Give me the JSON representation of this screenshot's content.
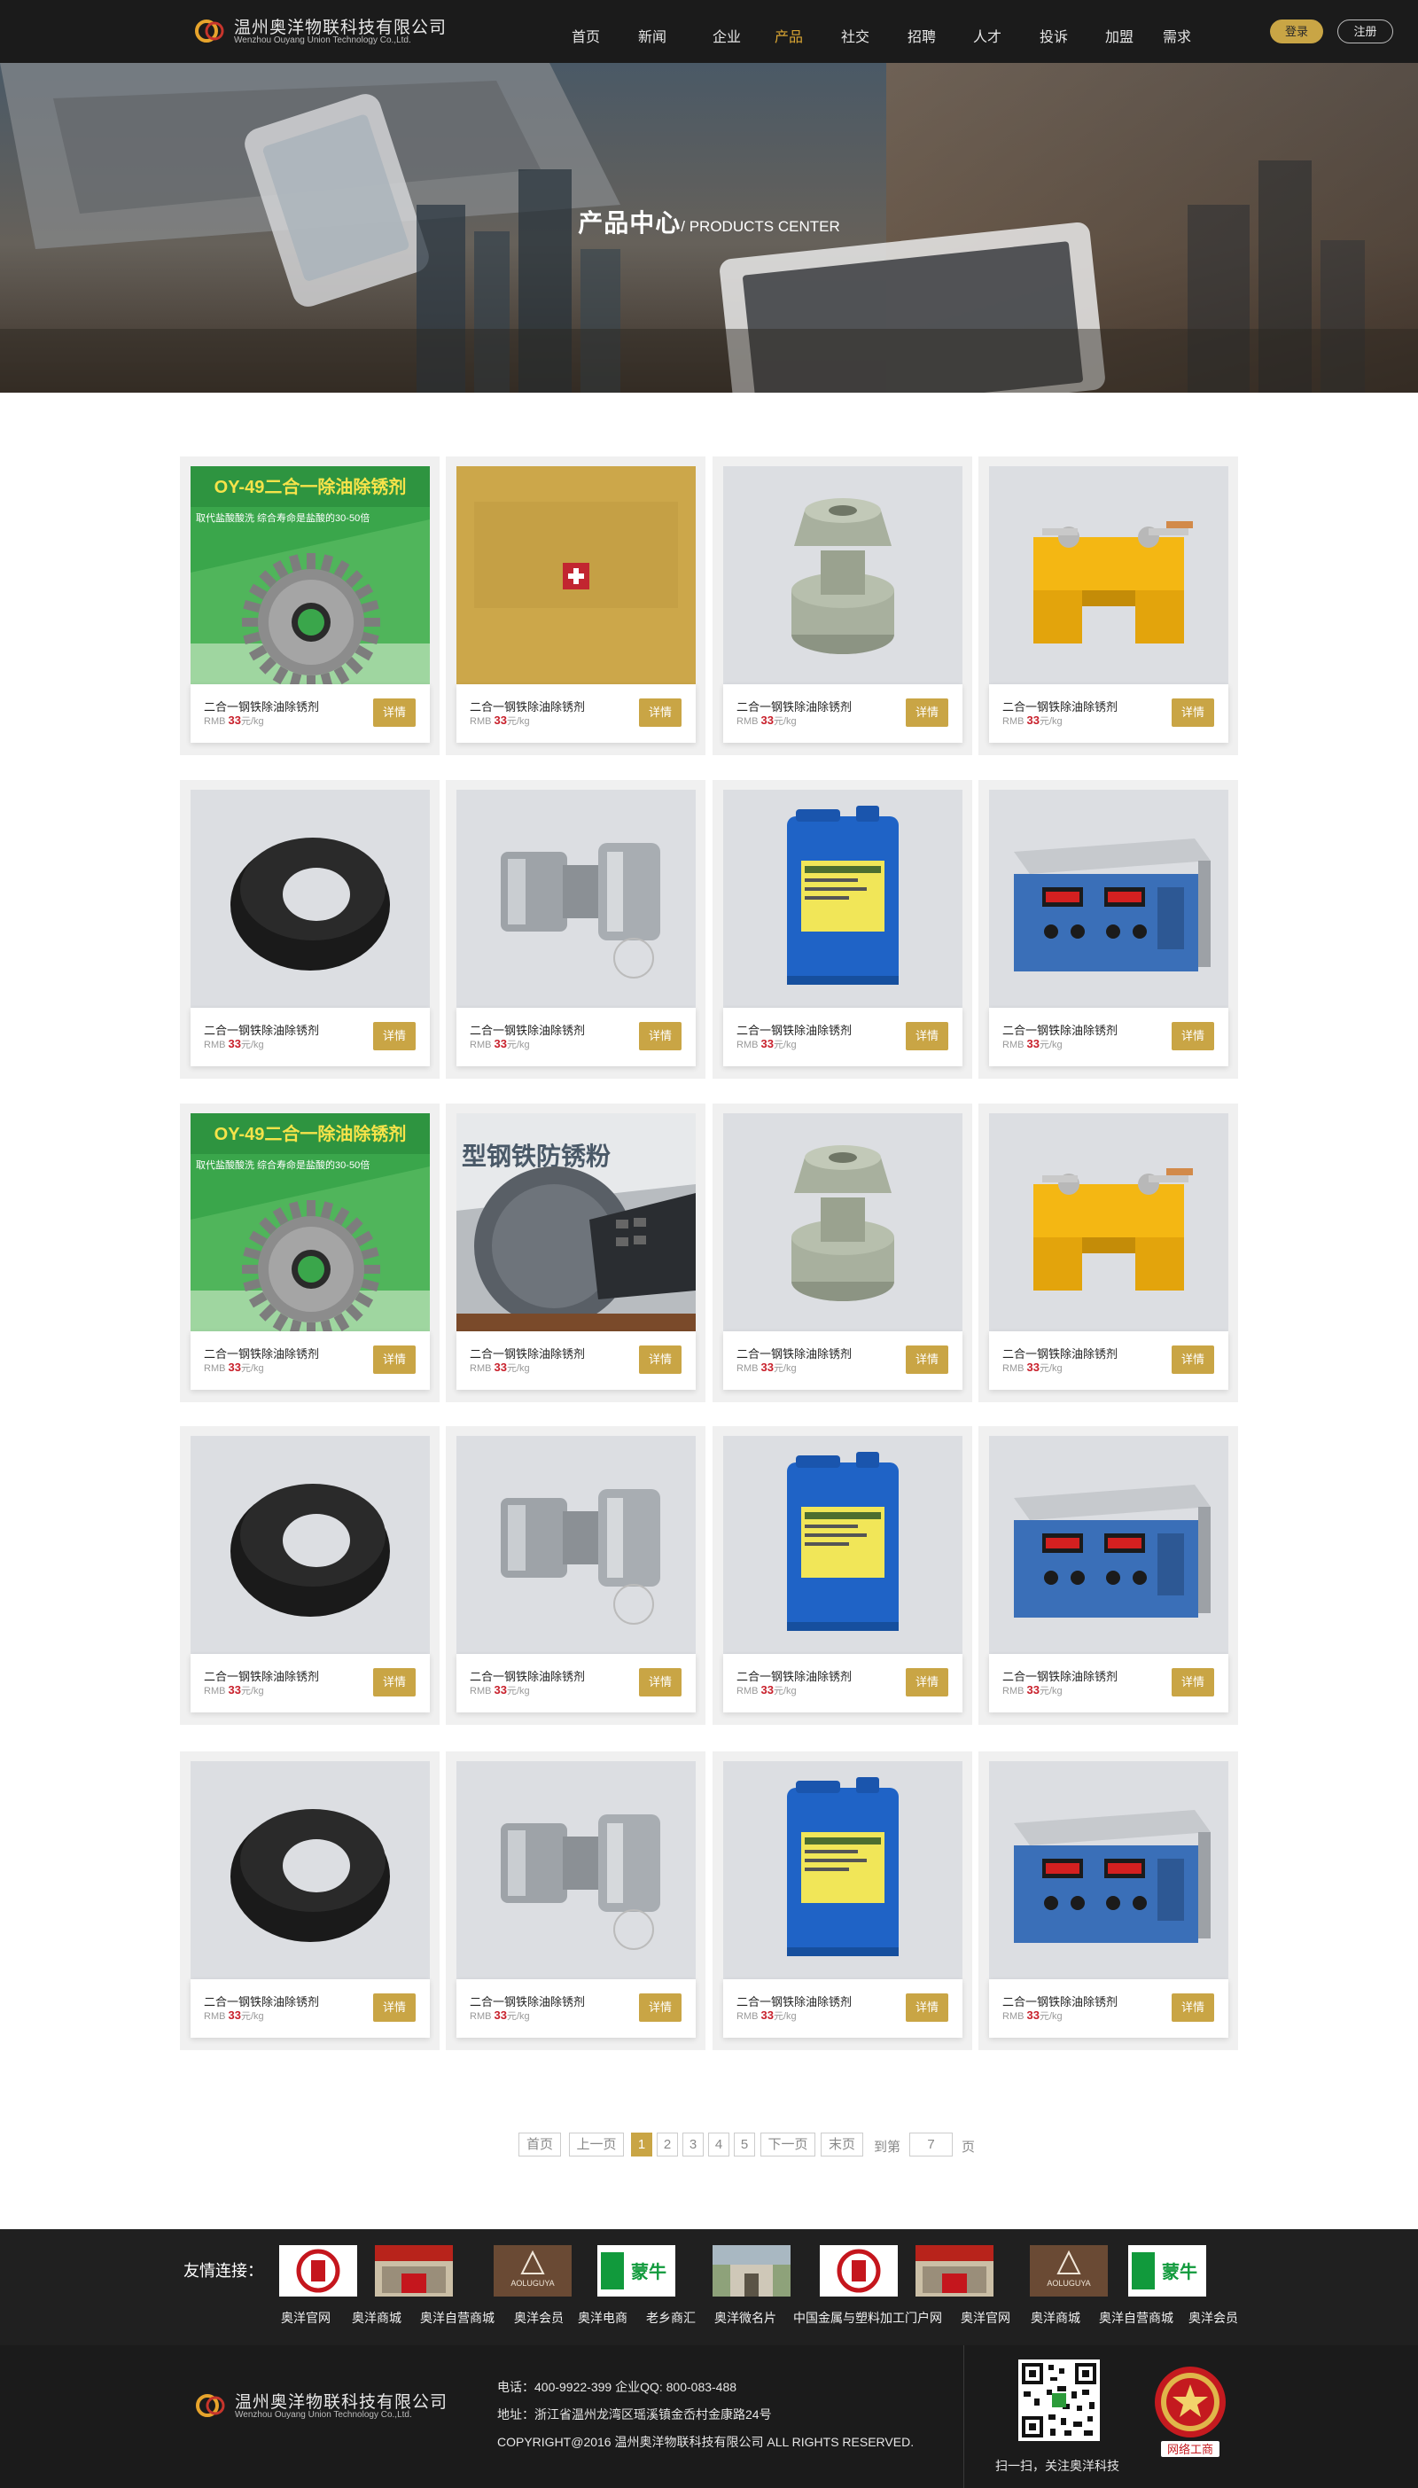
{
  "header": {
    "company_cn": "温州奥洋物联科技有限公司",
    "company_en": "Wenzhou Ouyang Union Technology Co.,Ltd.",
    "nav": [
      "首页",
      "新闻",
      "企业",
      "产品",
      "社交",
      "招聘",
      "人才",
      "投诉",
      "加盟",
      "需求"
    ],
    "active_nav": "产品",
    "login": "登录",
    "register": "注册"
  },
  "banner": {
    "title_cn": "产品中心",
    "title_en": "/ PRODUCTS CENTER"
  },
  "products": [
    {
      "name": "二合一钢铁除油除锈剂",
      "currency": "RMB",
      "price": "33",
      "unit": "元/kg",
      "image": "gear-ad",
      "detail": "详情"
    },
    {
      "name": "二合一钢铁除油除锈剂",
      "currency": "RMB",
      "price": "33",
      "unit": "元/kg",
      "image": "gold-overlay",
      "detail": "详情"
    },
    {
      "name": "二合一钢铁除油除锈剂",
      "currency": "RMB",
      "price": "33",
      "unit": "元/kg",
      "image": "plastic-fitting",
      "detail": "详情"
    },
    {
      "name": "二合一钢铁除油除锈剂",
      "currency": "RMB",
      "price": "33",
      "unit": "元/kg",
      "image": "yellow-clamp",
      "detail": "详情"
    },
    {
      "name": "二合一钢铁除油除锈剂",
      "currency": "RMB",
      "price": "33",
      "unit": "元/kg",
      "image": "rubber-ring",
      "detail": "详情"
    },
    {
      "name": "二合一钢铁除油除锈剂",
      "currency": "RMB",
      "price": "33",
      "unit": "元/kg",
      "image": "steel-coupling",
      "detail": "详情"
    },
    {
      "name": "二合一钢铁除油除锈剂",
      "currency": "RMB",
      "price": "33",
      "unit": "元/kg",
      "image": "blue-drum",
      "detail": "详情"
    },
    {
      "name": "二合一钢铁除油除锈剂",
      "currency": "RMB",
      "price": "33",
      "unit": "元/kg",
      "image": "power-supply",
      "detail": "详情"
    },
    {
      "name": "二合一钢铁除油除锈剂",
      "currency": "RMB",
      "price": "33",
      "unit": "元/kg",
      "image": "gear-ad",
      "detail": "详情"
    },
    {
      "name": "二合一钢铁除油除锈剂",
      "currency": "RMB",
      "price": "33",
      "unit": "元/kg",
      "image": "saw-calculator",
      "detail": "详情"
    },
    {
      "name": "二合一钢铁除油除锈剂",
      "currency": "RMB",
      "price": "33",
      "unit": "元/kg",
      "image": "plastic-fitting",
      "detail": "详情"
    },
    {
      "name": "二合一钢铁除油除锈剂",
      "currency": "RMB",
      "price": "33",
      "unit": "元/kg",
      "image": "yellow-clamp",
      "detail": "详情"
    },
    {
      "name": "二合一钢铁除油除锈剂",
      "currency": "RMB",
      "price": "33",
      "unit": "元/kg",
      "image": "rubber-ring",
      "detail": "详情"
    },
    {
      "name": "二合一钢铁除油除锈剂",
      "currency": "RMB",
      "price": "33",
      "unit": "元/kg",
      "image": "steel-coupling",
      "detail": "详情"
    },
    {
      "name": "二合一钢铁除油除锈剂",
      "currency": "RMB",
      "price": "33",
      "unit": "元/kg",
      "image": "blue-drum",
      "detail": "详情"
    },
    {
      "name": "二合一钢铁除油除锈剂",
      "currency": "RMB",
      "price": "33",
      "unit": "元/kg",
      "image": "power-supply",
      "detail": "详情"
    },
    {
      "name": "二合一钢铁除油除锈剂",
      "currency": "RMB",
      "price": "33",
      "unit": "元/kg",
      "image": "rubber-ring",
      "detail": "详情"
    },
    {
      "name": "二合一钢铁除油除锈剂",
      "currency": "RMB",
      "price": "33",
      "unit": "元/kg",
      "image": "steel-coupling",
      "detail": "详情"
    },
    {
      "name": "二合一钢铁除油除锈剂",
      "currency": "RMB",
      "price": "33",
      "unit": "元/kg",
      "image": "blue-drum",
      "detail": "详情"
    },
    {
      "name": "二合一钢铁除油除锈剂",
      "currency": "RMB",
      "price": "33",
      "unit": "元/kg",
      "image": "power-supply",
      "detail": "详情"
    }
  ],
  "gear_ad": {
    "headline": "OY-49二合一除油除锈剂",
    "subline": "取代盐酸酸洗 综合寿命是盐酸的30-50倍"
  },
  "saw_ad": {
    "headline": "型钢铁防锈粉"
  },
  "pagination": {
    "first": "首页",
    "prev": "上一页",
    "pages": [
      "1",
      "2",
      "3",
      "4",
      "5"
    ],
    "current": "1",
    "next": "下一页",
    "last": "末页",
    "goto_label": "到第",
    "goto_value": "7",
    "page_suffix": "页"
  },
  "links": {
    "label": "友情连接：",
    "logos": [
      "red-seal",
      "gate-banner",
      "aoluguya",
      "mengniu",
      "park-gate",
      "red-seal",
      "gate-banner",
      "aoluguya",
      "mengniu"
    ],
    "aoluguya_text": "AOLUGUYA",
    "mengniu_text": "蒙牛",
    "items": [
      "奥洋官网",
      "奥洋商城",
      "奥洋自营商城",
      "奥洋会员",
      "奥洋电商",
      "老乡商汇",
      "奥洋微名片",
      "中国金属与塑料加工门户网",
      "奥洋官网",
      "奥洋商城",
      "奥洋自营商城",
      "奥洋会员"
    ]
  },
  "footer": {
    "company_cn": "温州奥洋物联科技有限公司",
    "company_en": "Wenzhou Ouyang Union Technology Co.,Ltd.",
    "phone_line": "电话：400-9922-399    企业QQ: 800-083-488",
    "address_line": "地址：浙江省温州龙湾区瑶溪镇金岙村金康路24号",
    "copyright_line": "COPYRIGHT@2016 温州奥洋物联科技有限公司 ALL RIGHTS RESERVED.",
    "qr_caption": "扫一扫，关注奥洋科技",
    "badge_text": "网络工商"
  },
  "colors": {
    "accent_gold": "#c9a545",
    "nav_active": "#d9a533",
    "price_red": "#c8202b",
    "header_bg": "#1b1b1b"
  }
}
